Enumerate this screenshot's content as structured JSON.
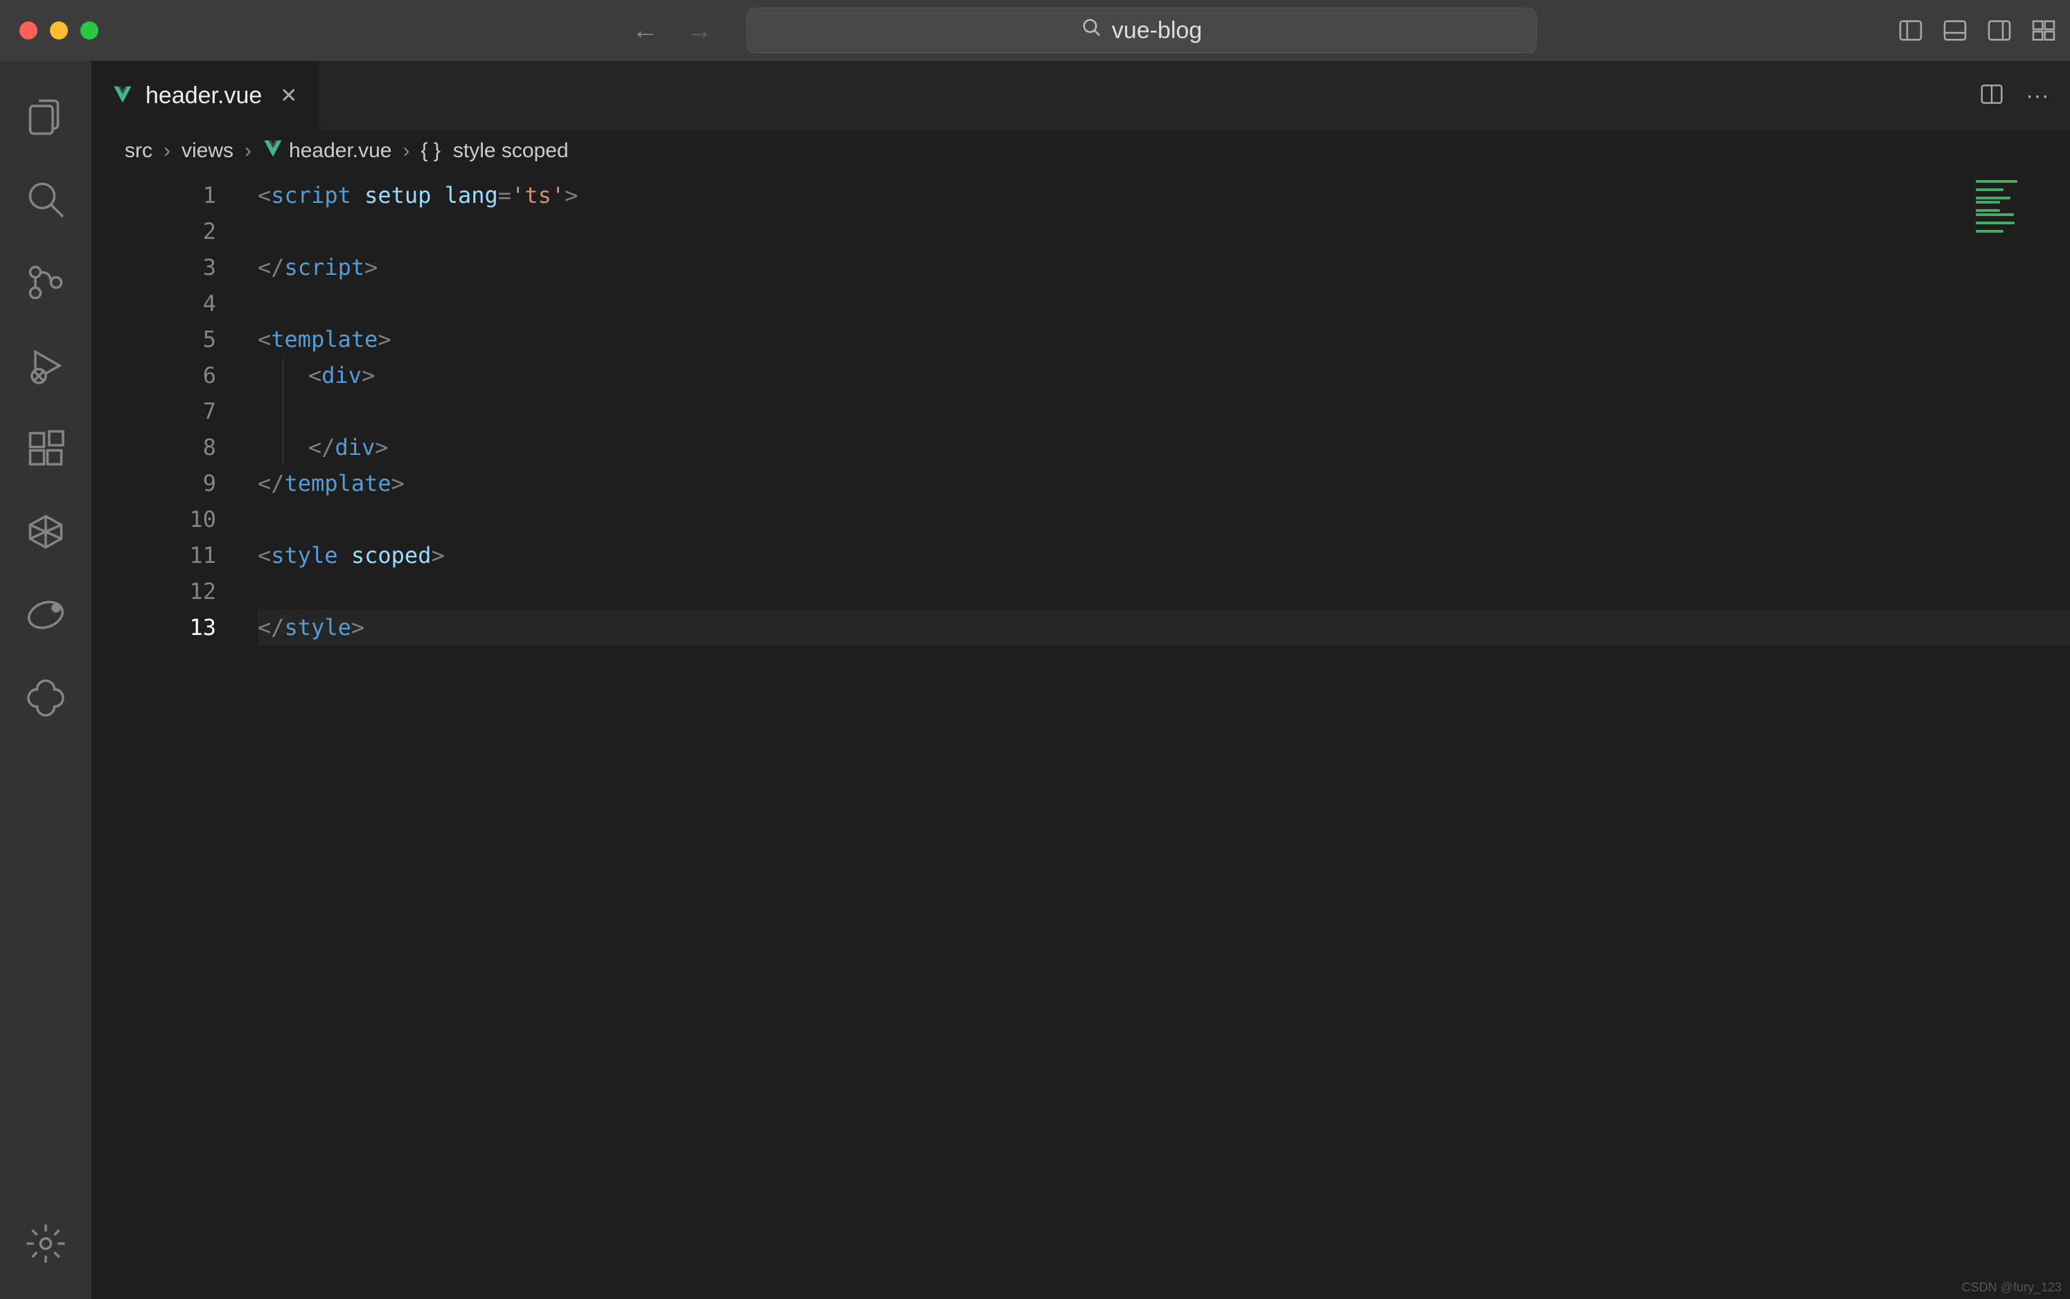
{
  "window": {
    "search_text": "vue-blog"
  },
  "tab": {
    "filename": "header.vue"
  },
  "breadcrumbs": {
    "parts": [
      "src",
      "views",
      "header.vue"
    ],
    "symbol_prefix": "{ }",
    "symbol": "style scoped"
  },
  "code": {
    "total_lines": 13,
    "active_line": 13,
    "lines": [
      {
        "n": 1,
        "tokens": [
          {
            "t": "<",
            "c": "tok-punc"
          },
          {
            "t": "script",
            "c": "tok-tag"
          },
          {
            "t": " ",
            "c": ""
          },
          {
            "t": "setup",
            "c": "tok-attr"
          },
          {
            "t": " ",
            "c": ""
          },
          {
            "t": "lang",
            "c": "tok-attr"
          },
          {
            "t": "=",
            "c": "tok-punc"
          },
          {
            "t": "'ts'",
            "c": "tok-str"
          },
          {
            "t": ">",
            "c": "tok-punc"
          }
        ]
      },
      {
        "n": 2,
        "tokens": []
      },
      {
        "n": 3,
        "tokens": [
          {
            "t": "</",
            "c": "tok-punc"
          },
          {
            "t": "script",
            "c": "tok-tag"
          },
          {
            "t": ">",
            "c": "tok-punc"
          }
        ]
      },
      {
        "n": 4,
        "tokens": []
      },
      {
        "n": 5,
        "tokens": [
          {
            "t": "<",
            "c": "tok-punc"
          },
          {
            "t": "template",
            "c": "tok-tag"
          },
          {
            "t": ">",
            "c": "tok-punc"
          }
        ]
      },
      {
        "n": 6,
        "indent": 1,
        "guide": true,
        "tokens": [
          {
            "t": "<",
            "c": "tok-punc"
          },
          {
            "t": "div",
            "c": "tok-tag"
          },
          {
            "t": ">",
            "c": "tok-punc"
          }
        ]
      },
      {
        "n": 7,
        "indent": 1,
        "guide": true,
        "tokens": []
      },
      {
        "n": 8,
        "indent": 1,
        "guide": true,
        "tokens": [
          {
            "t": "</",
            "c": "tok-punc"
          },
          {
            "t": "div",
            "c": "tok-tag"
          },
          {
            "t": ">",
            "c": "tok-punc"
          }
        ]
      },
      {
        "n": 9,
        "tokens": [
          {
            "t": "</",
            "c": "tok-punc"
          },
          {
            "t": "template",
            "c": "tok-tag"
          },
          {
            "t": ">",
            "c": "tok-punc"
          }
        ]
      },
      {
        "n": 10,
        "tokens": []
      },
      {
        "n": 11,
        "tokens": [
          {
            "t": "<",
            "c": "tok-punc"
          },
          {
            "t": "style",
            "c": "tok-tag"
          },
          {
            "t": " ",
            "c": ""
          },
          {
            "t": "scoped",
            "c": "tok-attr"
          },
          {
            "t": ">",
            "c": "tok-punc"
          }
        ]
      },
      {
        "n": 12,
        "tokens": []
      },
      {
        "n": 13,
        "tokens": [
          {
            "t": "</",
            "c": "tok-punc"
          },
          {
            "t": "style",
            "c": "tok-tag"
          },
          {
            "t": ">",
            "c": "tok-punc"
          }
        ]
      }
    ]
  },
  "activity_items": [
    "explorer",
    "search",
    "scm",
    "run-debug",
    "extensions",
    "remote",
    "emmet",
    "chatgpt"
  ],
  "watermark": "CSDN @fury_123"
}
